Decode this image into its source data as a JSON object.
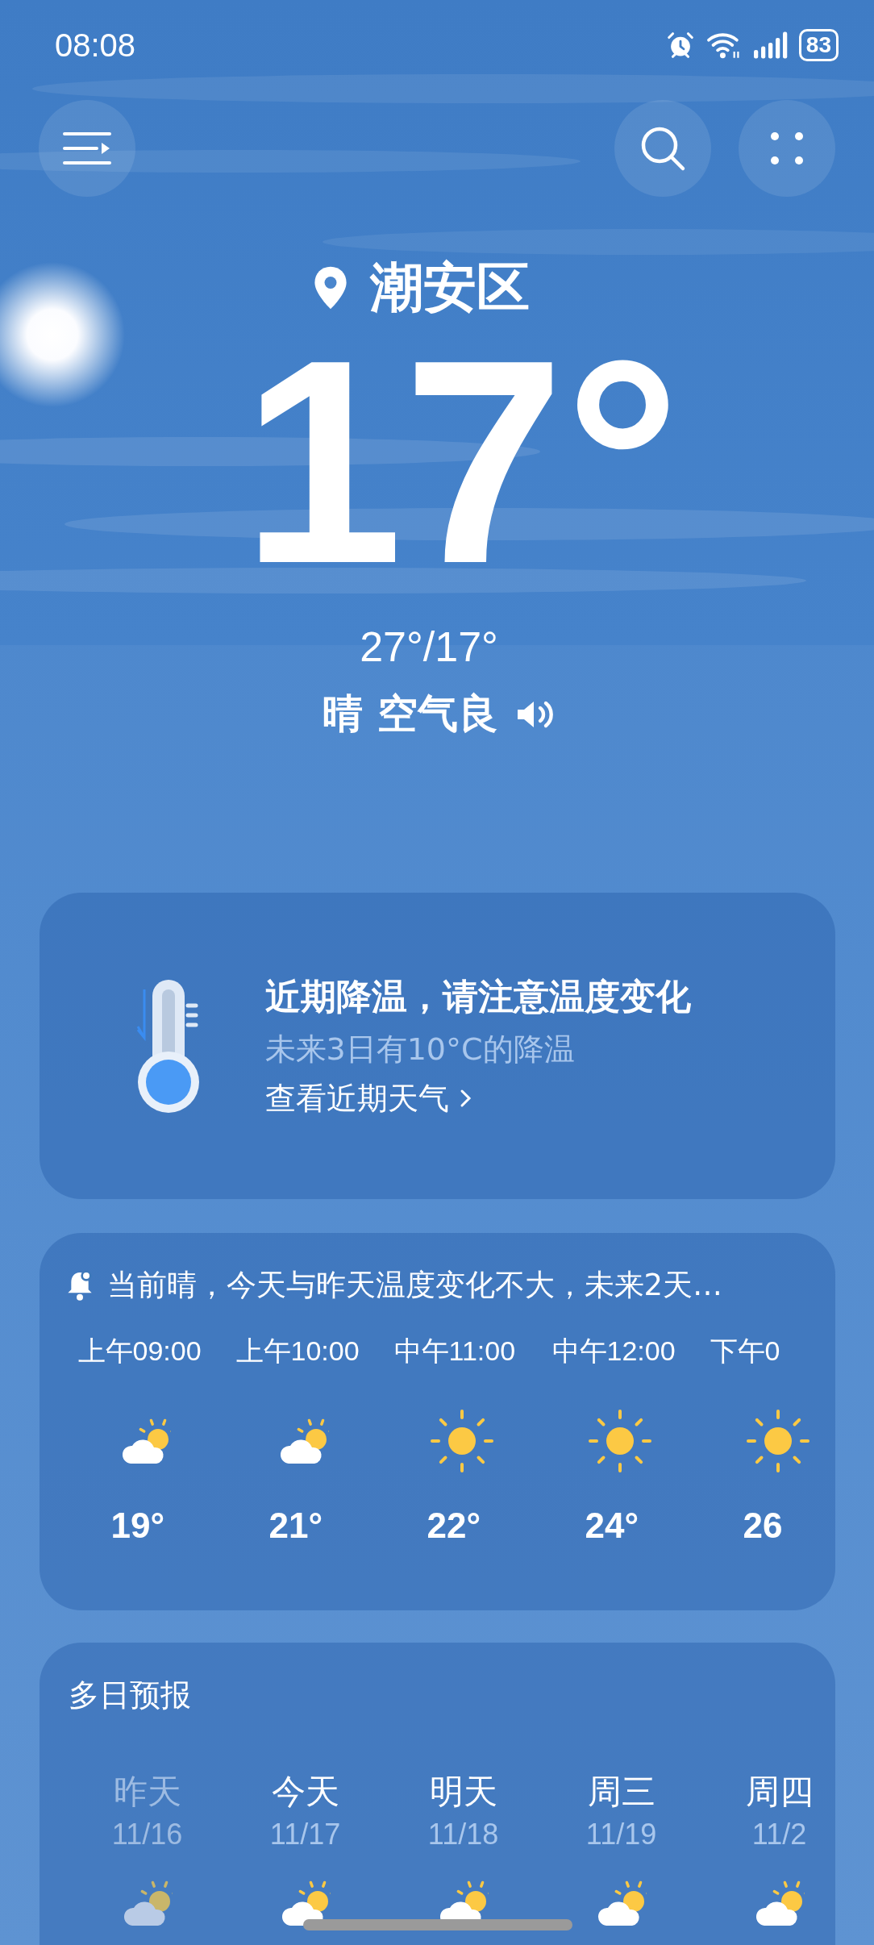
{
  "status_bar": {
    "time": "08:08",
    "battery": "83"
  },
  "location": "潮安区",
  "temperature": "17°",
  "high_low": "27°/17°",
  "condition": "晴 空气良",
  "alert_card": {
    "title": "近期降温，请注意温度变化",
    "subtitle": "未来3日有10°C的降温",
    "link": "查看近期天气"
  },
  "hourly": {
    "summary": "当前晴，今天与昨天温度变化不大，未来2天…",
    "hours": [
      {
        "time": "上午09:00",
        "kind": "partly-cloudy",
        "temp": "19°"
      },
      {
        "time": "上午10:00",
        "kind": "partly-cloudy",
        "temp": "21°"
      },
      {
        "time": "中午11:00",
        "kind": "sunny",
        "temp": "22°"
      },
      {
        "time": "中午12:00",
        "kind": "sunny",
        "temp": "24°"
      },
      {
        "time": "下午0",
        "kind": "sunny",
        "temp": "26"
      }
    ]
  },
  "daily": {
    "title": "多日预报",
    "days": [
      {
        "day": "昨天",
        "date": "11/16",
        "past": true,
        "kind": "partly-cloudy"
      },
      {
        "day": "今天",
        "date": "11/17",
        "past": false,
        "kind": "partly-cloudy"
      },
      {
        "day": "明天",
        "date": "11/18",
        "past": false,
        "kind": "partly-cloudy"
      },
      {
        "day": "周三",
        "date": "11/19",
        "past": false,
        "kind": "partly-cloudy"
      },
      {
        "day": "周四",
        "date": "11/2",
        "past": false,
        "kind": "partly-cloudy"
      }
    ]
  }
}
